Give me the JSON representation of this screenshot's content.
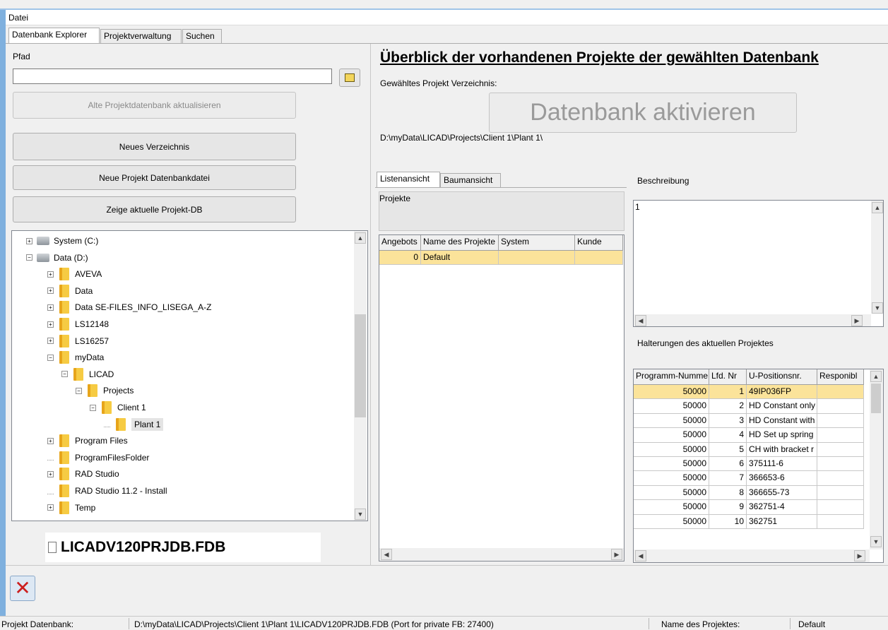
{
  "menu": {
    "file": "Datei"
  },
  "tabs": [
    "Datenbank Explorer",
    "Projektverwaltung",
    "Suchen"
  ],
  "left": {
    "pfad_label": "Pfad",
    "pfad_value": "",
    "btn_update_old": "Alte Projektdatenbank aktualisieren",
    "btn_new_dir": "Neues Verzeichnis",
    "btn_new_db": "Neue Projekt Datenbankdatei",
    "btn_show_db": "Zeige aktuelle Projekt-DB",
    "tree": [
      {
        "label": "System (C:)",
        "icon": "drive-icon",
        "expander": "+"
      },
      {
        "label": "Data (D:)",
        "icon": "drive-icon",
        "expander": "-"
      },
      {
        "label": "AVEVA",
        "icon": "folder-icon",
        "expander": "+"
      },
      {
        "label": "Data",
        "icon": "folder-icon",
        "expander": "+"
      },
      {
        "label": "Data SE-FILES_INFO_LISEGA_A-Z",
        "icon": "folder-icon",
        "expander": "+"
      },
      {
        "label": "LS12148",
        "icon": "folder-icon",
        "expander": "+"
      },
      {
        "label": "LS16257",
        "icon": "folder-icon",
        "expander": "+"
      },
      {
        "label": "myData",
        "icon": "folder-icon",
        "expander": "-"
      },
      {
        "label": "LICAD",
        "icon": "folder-icon",
        "expander": "-"
      },
      {
        "label": "Projects",
        "icon": "folder-icon",
        "expander": "-"
      },
      {
        "label": "Client 1",
        "icon": "folder-icon",
        "expander": "-"
      },
      {
        "label": "Plant 1",
        "icon": "folder-icon",
        "expander": ""
      },
      {
        "label": "Program Files",
        "icon": "folder-icon",
        "expander": "+"
      },
      {
        "label": "ProgramFilesFolder",
        "icon": "folder-icon",
        "expander": ""
      },
      {
        "label": "RAD Studio",
        "icon": "folder-icon",
        "expander": "+"
      },
      {
        "label": "RAD Studio 11.2 - Install",
        "icon": "folder-icon",
        "expander": ""
      },
      {
        "label": "Temp",
        "icon": "folder-icon",
        "expander": "+"
      }
    ],
    "file_name": "LICADV120PRJDB.FDB"
  },
  "right": {
    "heading": "Überblick der vorhandenen Projekte der gewählten Datenbank",
    "dir_label": "Gewähltes Projekt Verzeichnis:",
    "activate_btn": "Datenbank aktivieren",
    "dir_path": "D:\\myData\\LICAD\\Projects\\Client 1\\Plant 1\\",
    "subtabs": [
      "Listenansicht",
      "Baumansicht"
    ],
    "projects_label": "Projekte",
    "projects_cols": [
      "Angebots",
      "Name des Projekte",
      "System",
      "Kunde"
    ],
    "projects_rows": [
      [
        "0",
        "Default",
        "",
        ""
      ]
    ],
    "desc_label": "Beschreibung",
    "desc_text": "1",
    "supports_label": "Halterungen des aktuellen Projektes",
    "supports_cols": [
      "Programm-Numme",
      "Lfd. Nr",
      "U-Positionsnr.",
      "Responibl"
    ],
    "supports_rows": [
      [
        "50000",
        "1",
        "49IP036FP",
        ""
      ],
      [
        "50000",
        "2",
        "HD Constant only",
        ""
      ],
      [
        "50000",
        "3",
        "HD Constant with",
        ""
      ],
      [
        "50000",
        "4",
        "HD Set up spring",
        ""
      ],
      [
        "50000",
        "5",
        "CH with bracket r",
        ""
      ],
      [
        "50000",
        "6",
        "375111-6",
        ""
      ],
      [
        "50000",
        "7",
        "366653-6",
        ""
      ],
      [
        "50000",
        "8",
        "366655-73",
        ""
      ],
      [
        "50000",
        "9",
        "362751-4",
        ""
      ],
      [
        "50000",
        "10",
        "362751",
        ""
      ]
    ]
  },
  "status": {
    "db_label": "Projekt Datenbank:",
    "db_path": "D:\\myData\\LICAD\\Projects\\Client 1\\Plant 1\\LICADV120PRJDB.FDB (Port for private FB: 27400)",
    "proj_label": "Name des Projektes:",
    "proj_value": "Default"
  },
  "colors": {
    "selection": "#fbe39a",
    "close": "#cc1f1f",
    "accent_border": "#7fb0de"
  }
}
